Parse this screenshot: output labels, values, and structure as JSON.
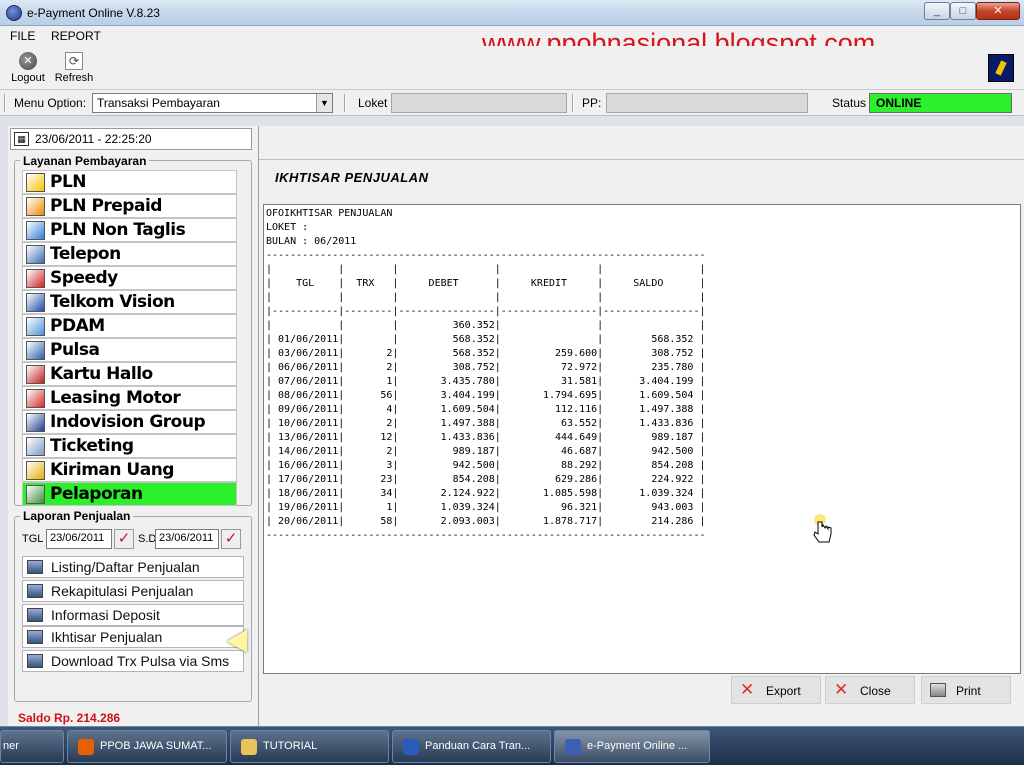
{
  "window": {
    "title": "e-Payment Online V.8.23"
  },
  "menu": {
    "file": "FILE",
    "report": "REPORT"
  },
  "watermark": "www.ppobnasional.blogspot.com",
  "toolbar": {
    "logout": "Logout",
    "refresh": "Refresh"
  },
  "options": {
    "menu_option_label": "Menu Option:",
    "menu_option_value": "Transaksi Pembayaran",
    "loket_label": "Loket",
    "pp_label": "PP:",
    "status_label": "Status",
    "status_value": "ONLINE",
    "status_color": "#2df02d"
  },
  "left": {
    "datetime": "23/06/2011 - 22:25:20",
    "layanan_title": "Layanan Pembayaran",
    "services": [
      {
        "label": "PLN",
        "icon": "pln-icon",
        "color": "#f5c400"
      },
      {
        "label": "PLN Prepaid",
        "icon": "pln-prepaid-icon",
        "color": "#f08a00"
      },
      {
        "label": "PLN Non Taglis",
        "icon": "pln-non-taglis-icon",
        "color": "#2f7fd6"
      },
      {
        "label": "Telepon",
        "icon": "telepon-icon",
        "color": "#3b6bb5"
      },
      {
        "label": "Speedy",
        "icon": "speedy-icon",
        "color": "#d62020"
      },
      {
        "label": "Telkom Vision",
        "icon": "telkom-vision-icon",
        "color": "#1f4aa3"
      },
      {
        "label": "PDAM",
        "icon": "pdam-icon",
        "color": "#4a90d9"
      },
      {
        "label": "Pulsa",
        "icon": "pulsa-icon",
        "color": "#2a5fb0"
      },
      {
        "label": "Kartu Hallo",
        "icon": "kartu-hallo-icon",
        "color": "#c41c1c"
      },
      {
        "label": "Leasing Motor",
        "icon": "leasing-motor-icon",
        "color": "#d42a2a"
      },
      {
        "label": "Indovision Group",
        "icon": "indovision-icon",
        "color": "#1e3f91"
      },
      {
        "label": "Ticketing",
        "icon": "ticketing-icon",
        "color": "#7a9cc6"
      },
      {
        "label": "Kiriman Uang",
        "icon": "kiriman-uang-icon",
        "color": "#e0b000"
      },
      {
        "label": "Pelaporan",
        "icon": "pelaporan-icon",
        "color": "#3a8f3a"
      }
    ],
    "laporan_title": "Laporan Penjualan",
    "tgl_label": "TGL",
    "tgl_value": "23/06/2011",
    "sd_label": "S.D",
    "sd_value": "23/06/2011",
    "report_buttons": [
      "Listing/Daftar Penjualan",
      "Rekapitulasi Penjualan",
      "Informasi Deposit",
      "Ikhtisar Penjualan",
      "Download Trx Pulsa via Sms"
    ],
    "saldo": "Saldo Rp.  214.286"
  },
  "content": {
    "heading": "IKHTISAR PENJUALAN",
    "report_header": [
      "OFOIKHTISAR PENJUALAN",
      "LOKET :",
      "BULAN : 06/2011"
    ],
    "columns": [
      "TGL",
      "TRX",
      "DEBET",
      "KREDIT",
      "SALDO"
    ],
    "rows": [
      [
        "",
        "",
        "360.352",
        "",
        ""
      ],
      [
        "01/06/2011",
        "",
        "568.352",
        "",
        "568.352"
      ],
      [
        "03/06/2011",
        "2",
        "568.352",
        "259.600",
        "308.752"
      ],
      [
        "06/06/2011",
        "2",
        "308.752",
        "72.972",
        "235.780"
      ],
      [
        "07/06/2011",
        "1",
        "3.435.780",
        "31.581",
        "3.404.199"
      ],
      [
        "08/06/2011",
        "56",
        "3.404.199",
        "1.794.695",
        "1.609.504"
      ],
      [
        "09/06/2011",
        "4",
        "1.609.504",
        "112.116",
        "1.497.388"
      ],
      [
        "10/06/2011",
        "2",
        "1.497.388",
        "63.552",
        "1.433.836"
      ],
      [
        "13/06/2011",
        "12",
        "1.433.836",
        "444.649",
        "989.187"
      ],
      [
        "14/06/2011",
        "2",
        "989.187",
        "46.687",
        "942.500"
      ],
      [
        "16/06/2011",
        "3",
        "942.500",
        "88.292",
        "854.208"
      ],
      [
        "17/06/2011",
        "23",
        "854.208",
        "629.286",
        "224.922"
      ],
      [
        "18/06/2011",
        "34",
        "2.124.922",
        "1.085.598",
        "1.039.324"
      ],
      [
        "19/06/2011",
        "1",
        "1.039.324",
        "96.321",
        "943.003"
      ],
      [
        "20/06/2011",
        "58",
        "2.093.003",
        "1.878.717",
        "214.286"
      ]
    ],
    "buttons": {
      "export": "Export",
      "close": "Close",
      "print": "Print"
    }
  },
  "taskbar": [
    {
      "label": "ner",
      "icon": "",
      "color": "#000000"
    },
    {
      "label": "PPOB JAWA SUMAT...",
      "icon": "firefox-icon",
      "color": "#e66000"
    },
    {
      "label": "TUTORIAL",
      "icon": "folder-icon",
      "color": "#e8c45a"
    },
    {
      "label": "Panduan Cara Tran...",
      "icon": "word-icon",
      "color": "#2b5bb8"
    },
    {
      "label": "e-Payment Online ...",
      "icon": "epayment-icon",
      "color": "#3b5fb5"
    }
  ]
}
